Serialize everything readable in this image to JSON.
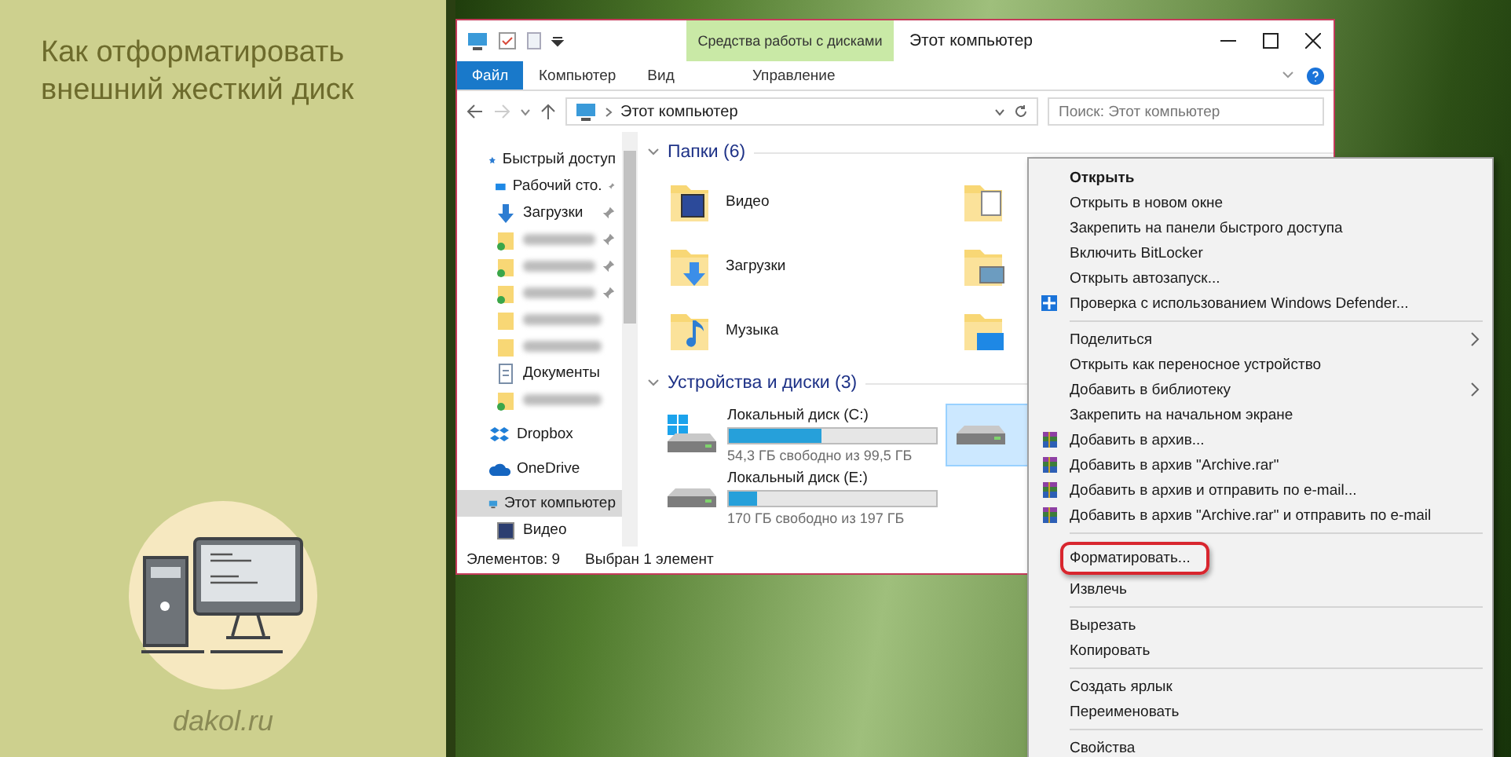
{
  "banner": {
    "title": "Как отформатировать внешний жесткий диск",
    "site": "dakol.ru"
  },
  "window": {
    "title": "Этот компьютер",
    "context_tab": "Средства работы с дисками",
    "ribbon_tabs": [
      {
        "label": "Файл",
        "kind": "file"
      },
      {
        "label": "Компьютер",
        "kind": "tab"
      },
      {
        "label": "Вид",
        "kind": "tab"
      },
      {
        "label": "Управление",
        "kind": "context"
      }
    ],
    "address": "Этот компьютер",
    "search": {
      "placeholder": "Поиск: Этот компьютер"
    }
  },
  "nav": [
    {
      "kind": "quick",
      "label": "Быстрый доступ",
      "selected": false,
      "children": [
        {
          "kind": "desktop",
          "label": "Рабочий сто.",
          "pinned": true,
          "selected": false
        },
        {
          "kind": "downloads",
          "label": "Загрузки",
          "pinned": true,
          "selected": false
        },
        {
          "kind": "synced",
          "pinned": true,
          "selected": false
        },
        {
          "kind": "synced",
          "pinned": true,
          "selected": false
        },
        {
          "kind": "synced",
          "pinned": true,
          "selected": false
        },
        {
          "kind": "folder",
          "pinned": false,
          "selected": false
        },
        {
          "kind": "folder",
          "pinned": false,
          "selected": false
        },
        {
          "kind": "documents",
          "label": "Документы",
          "pinned": false,
          "selected": false
        },
        {
          "kind": "synced",
          "pinned": false,
          "selected": false
        }
      ]
    },
    {
      "kind": "dropbox",
      "label": "Dropbox",
      "selected": false
    },
    {
      "kind": "onedrive",
      "label": "OneDrive",
      "selected": false
    },
    {
      "kind": "pc",
      "label": "Этот компьютер",
      "selected": true,
      "children": [
        {
          "kind": "video",
          "label": "Видео",
          "pinned": false,
          "selected": false
        }
      ]
    }
  ],
  "folders_title": "Папки (6)",
  "folders": [
    {
      "kind": "video",
      "label": "Видео"
    },
    {
      "kind": "documents"
    },
    {
      "kind": "downloads",
      "label": "Загрузки"
    },
    {
      "kind": "pictures"
    },
    {
      "kind": "music",
      "label": "Музыка"
    },
    {
      "kind": "desktop"
    }
  ],
  "devices_title": "Устройства и диски (3)",
  "drives": [
    {
      "kind": "system",
      "name": "Локальный диск (C:)",
      "free": "54,3 ГБ свободно из 99,5 ГБ",
      "level": 0.45,
      "selected": false
    },
    {
      "kind": "removable",
      "selected": true
    },
    {
      "kind": "disk",
      "name": "Локальный диск (E:)",
      "free": "170 ГБ свободно из 197 ГБ",
      "level": 0.14,
      "selected": false
    }
  ],
  "status": {
    "count": "Элементов: 9",
    "selection": "Выбран 1 элемент"
  },
  "menu": [
    {
      "kind": "item",
      "label": "Открыть",
      "bold": true
    },
    {
      "kind": "item",
      "label": "Открыть в новом окне"
    },
    {
      "kind": "item",
      "label": "Закрепить на панели быстрого доступа"
    },
    {
      "kind": "item",
      "label": "Включить BitLocker"
    },
    {
      "kind": "item",
      "label": "Открыть автозапуск..."
    },
    {
      "kind": "defender",
      "label": "Проверка с использованием Windows Defender..."
    },
    {
      "kind": "separator"
    },
    {
      "kind": "item",
      "label": "Поделиться",
      "submenu": true
    },
    {
      "kind": "item",
      "label": "Открыть как переносное устройство"
    },
    {
      "kind": "item",
      "label": "Добавить в библиотеку",
      "submenu": true
    },
    {
      "kind": "item",
      "label": "Закрепить на начальном экране"
    },
    {
      "kind": "archive",
      "label": "Добавить в архив..."
    },
    {
      "kind": "archive",
      "label": "Добавить в архив \"Archive.rar\""
    },
    {
      "kind": "archive",
      "label": "Добавить в архив и отправить по e-mail..."
    },
    {
      "kind": "archive",
      "label": "Добавить в архив \"Archive.rar\" и отправить по e-mail"
    },
    {
      "kind": "separator"
    },
    {
      "kind": "item",
      "label": "Форматировать...",
      "highlighted": true
    },
    {
      "kind": "item",
      "label": "Извлечь"
    },
    {
      "kind": "separator"
    },
    {
      "kind": "item",
      "label": "Вырезать"
    },
    {
      "kind": "item",
      "label": "Копировать"
    },
    {
      "kind": "separator"
    },
    {
      "kind": "item",
      "label": "Создать ярлык"
    },
    {
      "kind": "item",
      "label": "Переименовать"
    },
    {
      "kind": "separator"
    },
    {
      "kind": "item",
      "label": "Свойства"
    }
  ]
}
